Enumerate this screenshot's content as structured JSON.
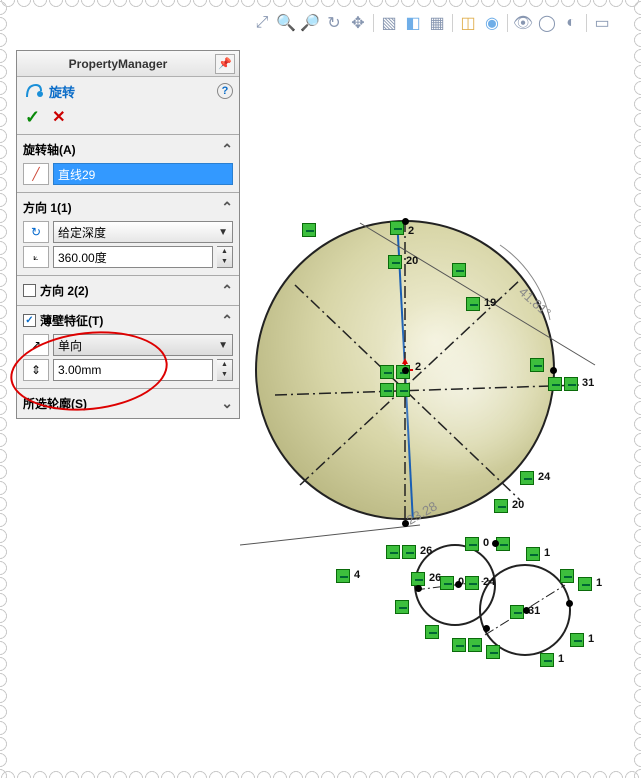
{
  "pm": {
    "title": "PropertyManager"
  },
  "feature": {
    "name": "旋转",
    "help": "?"
  },
  "actions": {
    "ok": "✓",
    "cancel": "✕"
  },
  "axis": {
    "title": "旋转轴(A)",
    "value": "直线29"
  },
  "dir1": {
    "title": "方向 1(1)",
    "type": "给定深度",
    "angle": "360.00度"
  },
  "dir2": {
    "title": "方向 2(2)",
    "checked": false
  },
  "thin": {
    "title": "薄壁特征(T)",
    "checked": true,
    "dir": "单向",
    "thickness": "3.00mm"
  },
  "contour": {
    "title": "所选轮廓(S)"
  },
  "dims": {
    "angle": "41.81°",
    "radius": "23.28"
  },
  "scene_labels": {
    "n2": "2",
    "n20": "20",
    "n19": "19",
    "n31": "31",
    "n24": "24",
    "n4": "4",
    "n26": "26",
    "n0": "0",
    "n1": "1"
  }
}
